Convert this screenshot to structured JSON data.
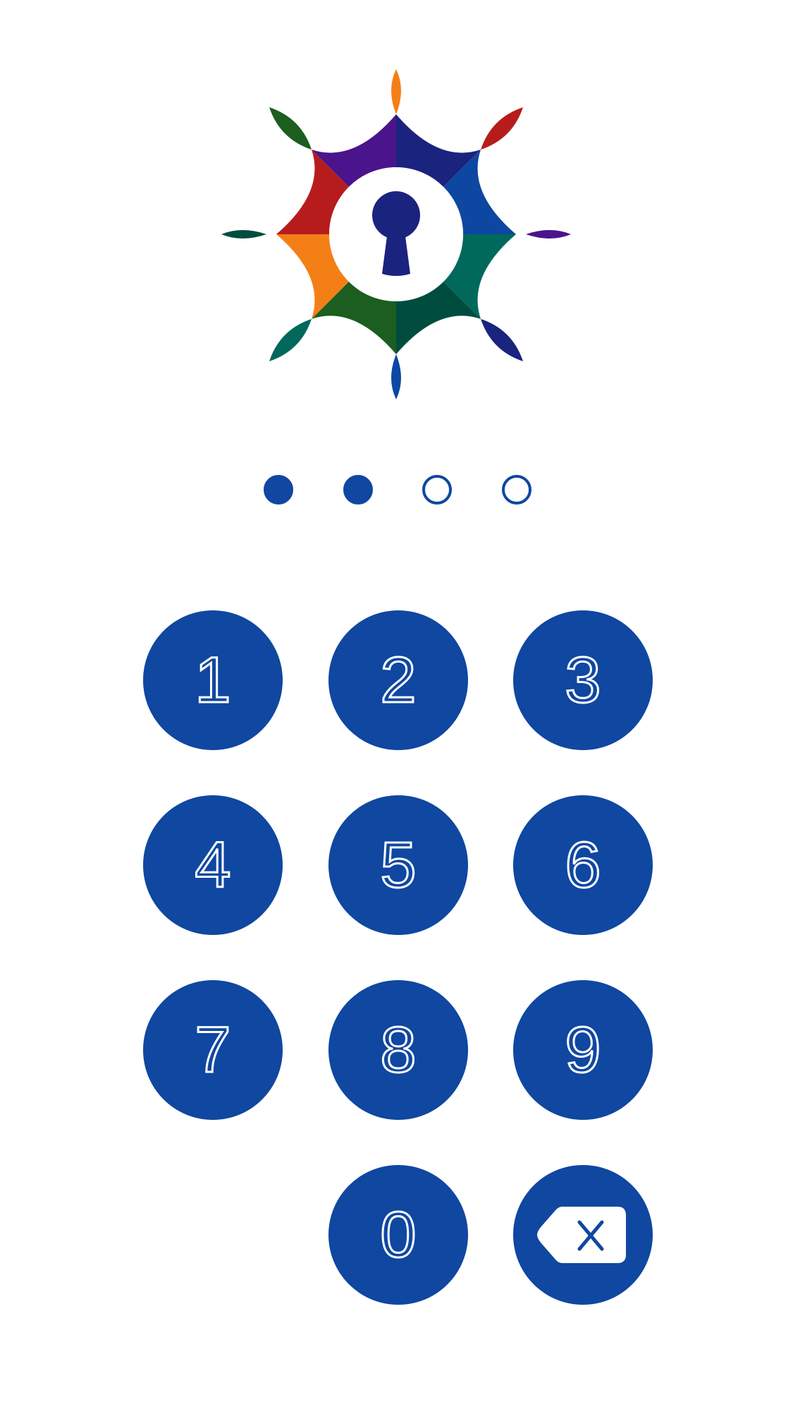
{
  "colors": {
    "primary": "#0f47a1",
    "background": "#ffffff",
    "logo_palette": [
      "#f47f17",
      "#b71c1c",
      "#1b5e20",
      "#4a148c",
      "#1a237e",
      "#0d47a1",
      "#00695c",
      "#004d40"
    ]
  },
  "logo": {
    "icon": "keyhole-icon"
  },
  "pin": {
    "length": 4,
    "entered": 2
  },
  "keypad": {
    "keys": [
      "1",
      "2",
      "3",
      "4",
      "5",
      "6",
      "7",
      "8",
      "9",
      "0"
    ],
    "delete_icon": "backspace-icon"
  }
}
